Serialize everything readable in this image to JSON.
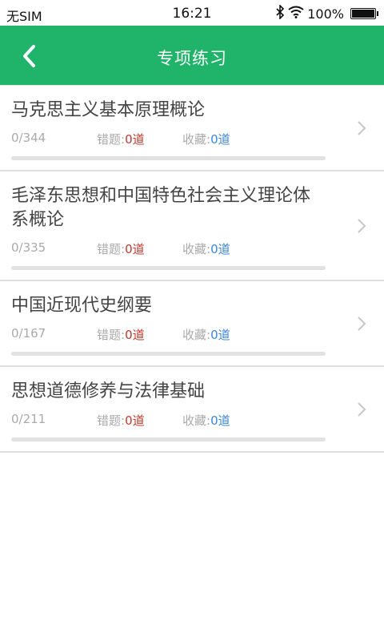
{
  "status": {
    "carrier": "无SIM",
    "time": "16:21",
    "battery": "100%"
  },
  "header": {
    "title": "专项练习"
  },
  "items": [
    {
      "name": "马克思主义基本原理概论",
      "count": "0/344",
      "wrong_label": "错题:",
      "wrong_value": "0道",
      "fav_label": "收藏:",
      "fav_value": "0道",
      "progress": 0
    },
    {
      "name": "毛泽东思想和中国特色社会主义理论体系概论",
      "count": "0/335",
      "wrong_label": "错题:",
      "wrong_value": "0道",
      "fav_label": "收藏:",
      "fav_value": "0道",
      "progress": 0
    },
    {
      "name": "中国近现代史纲要",
      "count": "0/167",
      "wrong_label": "错题:",
      "wrong_value": "0道",
      "fav_label": "收藏:",
      "fav_value": "0道",
      "progress": 0
    },
    {
      "name": "思想道德修养与法律基础",
      "count": "0/211",
      "wrong_label": "错题:",
      "wrong_value": "0道",
      "fav_label": "收藏:",
      "fav_value": "0道",
      "progress": 0
    }
  ],
  "colors": {
    "accent": "#1fb46a",
    "wrong": "#c0392b",
    "fav": "#3b87d6"
  },
  "icons": {
    "back": "chevron-left-icon",
    "row": "chevron-right-icon"
  }
}
